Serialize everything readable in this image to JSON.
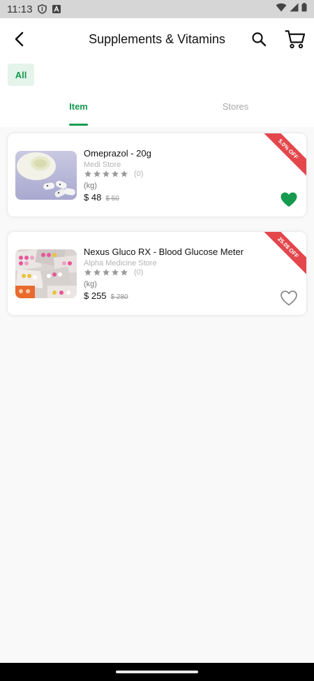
{
  "status_bar": {
    "time": "11:13"
  },
  "app_bar": {
    "title": "Supplements & Vitamins"
  },
  "filters": {
    "all_label": "All"
  },
  "tabs": [
    {
      "label": "Item",
      "active": true
    },
    {
      "label": "Stores",
      "active": false
    }
  ],
  "products": [
    {
      "name": "Omeprazol - 20g",
      "store": "Medi Store",
      "rating_count": "(0)",
      "unit": "(kg)",
      "price": "$ 48",
      "old_price": "$ 50",
      "discount": "5.0% OFF",
      "favorite": true
    },
    {
      "name": "Nexus Gluco RX - Blood Glucose Meter",
      "store": "Alpha Medicine Store",
      "rating_count": "(0)",
      "unit": "(kg)",
      "price": "$ 255",
      "old_price": "$ 280",
      "discount": "25.0$ OFF",
      "favorite": false
    }
  ],
  "colors": {
    "accent": "#169a4e",
    "discount": "#e3474c"
  }
}
